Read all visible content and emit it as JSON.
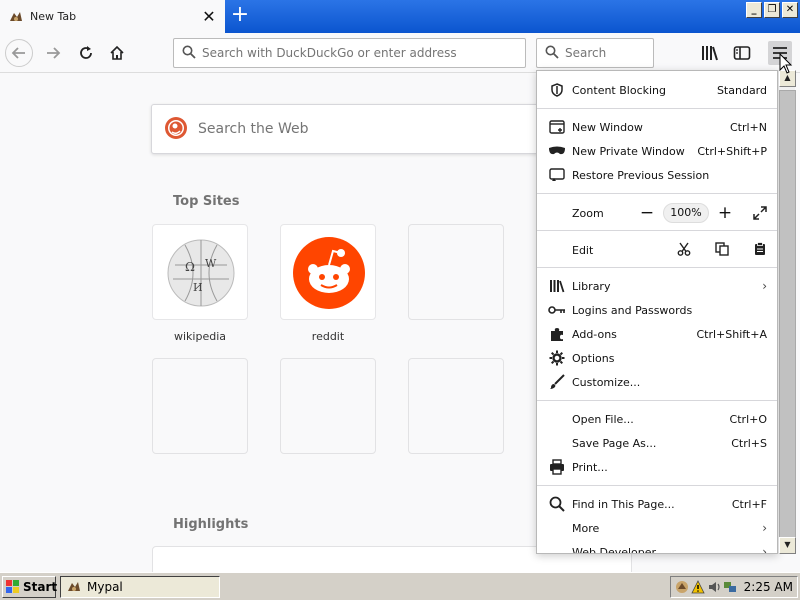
{
  "tab": {
    "title": "New Tab"
  },
  "navbar": {
    "url_placeholder": "Search with DuckDuckGo or enter address",
    "search_placeholder": "Search"
  },
  "content": {
    "web_search_placeholder": "Search the Web",
    "top_sites_title": "Top Sites",
    "highlights_title": "Highlights",
    "top_sites": [
      {
        "label": "wikipedia"
      },
      {
        "label": "reddit"
      }
    ]
  },
  "menu": {
    "content_blocking": {
      "label": "Content Blocking",
      "value": "Standard"
    },
    "new_window": {
      "label": "New Window",
      "shortcut": "Ctrl+N"
    },
    "new_private_window": {
      "label": "New Private Window",
      "shortcut": "Ctrl+Shift+P"
    },
    "restore_session": {
      "label": "Restore Previous Session"
    },
    "zoom": {
      "label": "Zoom",
      "minus": "−",
      "value": "100%",
      "plus": "+"
    },
    "edit": {
      "label": "Edit"
    },
    "library": {
      "label": "Library"
    },
    "logins": {
      "label": "Logins and Passwords"
    },
    "addons": {
      "label": "Add-ons",
      "shortcut": "Ctrl+Shift+A"
    },
    "options": {
      "label": "Options"
    },
    "customize": {
      "label": "Customize..."
    },
    "open_file": {
      "label": "Open File...",
      "shortcut": "Ctrl+O"
    },
    "save_page": {
      "label": "Save Page As...",
      "shortcut": "Ctrl+S"
    },
    "print": {
      "label": "Print..."
    },
    "find": {
      "label": "Find in This Page...",
      "shortcut": "Ctrl+F"
    },
    "more": {
      "label": "More"
    },
    "web_developer": {
      "label": "Web Developer"
    }
  },
  "taskbar": {
    "start_label": "Start",
    "task_label": "Mypal",
    "clock": "2:25 AM"
  },
  "colors": {
    "tabbar_blue": "#0b55cf",
    "reddit_orange": "#ff4500",
    "ddg_orange": "#de5833"
  }
}
